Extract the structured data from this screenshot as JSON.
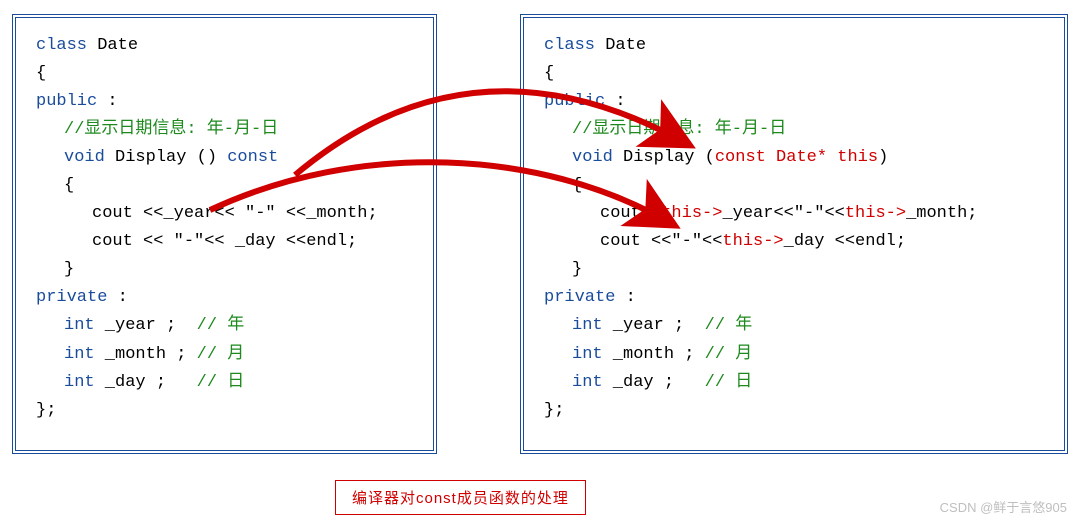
{
  "left": {
    "l1": {
      "kw": "class",
      "name": " Date"
    },
    "l2": "{",
    "l3": {
      "kw": "public",
      "colon": " :"
    },
    "l4": "//显示日期信息: 年-月-日",
    "l5": {
      "kw": "void",
      "name": " Display () ",
      "const": "const"
    },
    "l6": "{",
    "l7": "cout <<_year<< \"-\" <<_month;",
    "l8": "cout << \"-\"<< _day <<endl;",
    "l9": "}",
    "l10": {
      "kw": "private",
      "colon": " :"
    },
    "l11": {
      "kw": "int",
      "name": " _year ;  ",
      "cm": "// 年"
    },
    "l12": {
      "kw": "int",
      "name": " _month ; ",
      "cm": "// 月"
    },
    "l13": {
      "kw": "int",
      "name": " _day ;   ",
      "cm": "// 日"
    },
    "l14": "};"
  },
  "right": {
    "l1": {
      "kw": "class",
      "name": " Date"
    },
    "l2": "{",
    "l3": {
      "kw": "public",
      "colon": " :"
    },
    "l4": "//显示日期信息: 年-月-日",
    "l5": {
      "kw": "void",
      "name": " Display (",
      "arg": "const Date* this",
      "close": ")"
    },
    "l6": "{",
    "l7": {
      "a": "cout<<",
      "t1": "this->",
      "b": "_year<<\"-\"<<",
      "t2": "this->",
      "c": "_month;"
    },
    "l8": {
      "a": "cout <<\"-\"<<",
      "t1": "this->",
      "b": "_day <<endl;"
    },
    "l9": "}",
    "l10": {
      "kw": "private",
      "colon": " :"
    },
    "l11": {
      "kw": "int",
      "name": " _year ;  ",
      "cm": "// 年"
    },
    "l12": {
      "kw": "int",
      "name": " _month ; ",
      "cm": "// 月"
    },
    "l13": {
      "kw": "int",
      "name": " _day ;   ",
      "cm": "// 日"
    },
    "l14": "};"
  },
  "caption": "编译器对const成员函数的处理",
  "watermark": "CSDN @鲜于言悠905"
}
